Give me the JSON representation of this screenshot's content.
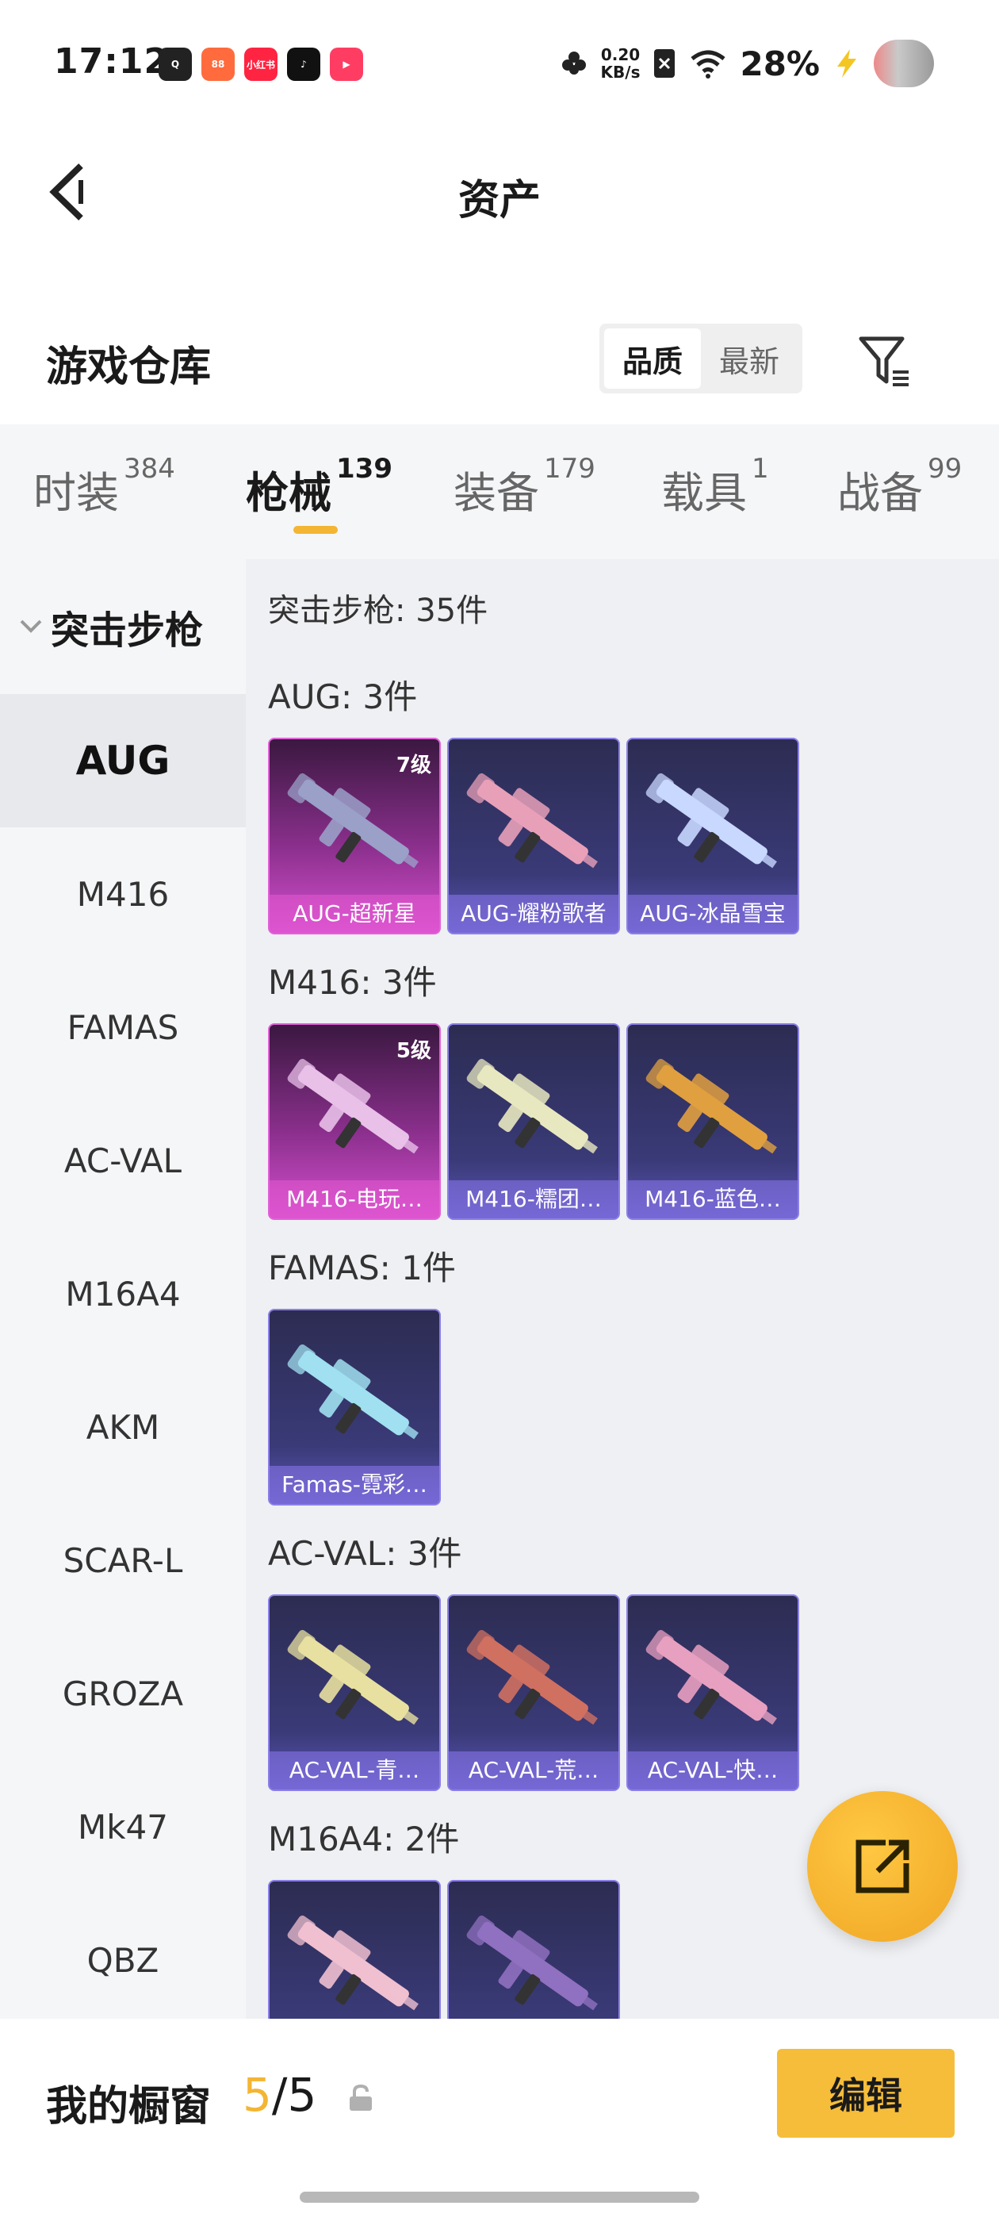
{
  "status_bar": {
    "time": "17:12",
    "apps": [
      {
        "name": "qq-browser-icon",
        "color": "#222222",
        "text": "Q"
      },
      {
        "name": "kuaishou-icon",
        "color": "#ff6b3d",
        "text": "88"
      },
      {
        "name": "xiaohongshu-icon",
        "color": "#ff2442",
        "text": "小红书"
      },
      {
        "name": "douyin-icon",
        "color": "#111111",
        "text": "♪"
      },
      {
        "name": "video-app-icon",
        "color": "#ff3d63",
        "text": "▶"
      }
    ],
    "net_speed_value": "0.20",
    "net_speed_unit": "KB/s",
    "battery": "28%"
  },
  "header": {
    "title": "资产"
  },
  "warehouse": {
    "title": "游戏仓库",
    "sort_options": [
      "品质",
      "最新"
    ],
    "active_sort": "品质"
  },
  "tabs": [
    {
      "label": "时装",
      "count": "384"
    },
    {
      "label": "枪械",
      "count": "139"
    },
    {
      "label": "装备",
      "count": "179"
    },
    {
      "label": "载具",
      "count": "1"
    },
    {
      "label": "战备",
      "count": "99"
    }
  ],
  "active_tab": "枪械",
  "sidebar": {
    "category": "突击步枪",
    "items": [
      "AUG",
      "M416",
      "FAMAS",
      "AC-VAL",
      "M16A4",
      "AKM",
      "SCAR-L",
      "GROZA",
      "Mk47",
      "QBZ"
    ],
    "active_item": "AUG"
  },
  "content": {
    "total": "突击步枪: 35件",
    "groups": [
      {
        "title": "AUG: 3件",
        "items": [
          {
            "name": "AUG-超新星",
            "level": "7级",
            "rarity": "pink",
            "color": "#9aa0c8"
          },
          {
            "name": "AUG-耀粉歌者",
            "level": "",
            "rarity": "purple",
            "color": "#e8a0b8"
          },
          {
            "name": "AUG-冰晶雪宝",
            "level": "",
            "rarity": "purple",
            "color": "#c8d8ff"
          }
        ]
      },
      {
        "title": "M416: 3件",
        "items": [
          {
            "name": "M416-电玩…",
            "level": "5级",
            "rarity": "pink",
            "color": "#e8c0e8"
          },
          {
            "name": "M416-糯团…",
            "level": "",
            "rarity": "purple",
            "color": "#e8e8c0"
          },
          {
            "name": "M416-蓝色…",
            "level": "",
            "rarity": "purple",
            "color": "#e0a040"
          }
        ]
      },
      {
        "title": "FAMAS: 1件",
        "items": [
          {
            "name": "Famas-霓彩…",
            "level": "",
            "rarity": "purple",
            "color": "#a0e0f0"
          }
        ]
      },
      {
        "title": "AC-VAL: 3件",
        "items": [
          {
            "name": "AC-VAL-青…",
            "level": "",
            "rarity": "purple",
            "color": "#e8e0a0"
          },
          {
            "name": "AC-VAL-荒…",
            "level": "",
            "rarity": "purple",
            "color": "#d07060"
          },
          {
            "name": "AC-VAL-快…",
            "level": "",
            "rarity": "purple",
            "color": "#e8a0c0"
          }
        ]
      },
      {
        "title": "M16A4: 2件",
        "items": [
          {
            "name": "",
            "level": "",
            "rarity": "purple",
            "color": "#f0c0d0"
          },
          {
            "name": "",
            "level": "",
            "rarity": "purple",
            "color": "#9070c0"
          }
        ]
      }
    ]
  },
  "showcase": {
    "label": "我的橱窗",
    "current": "5",
    "separator": "/",
    "total": "5",
    "edit_label": "编辑"
  }
}
